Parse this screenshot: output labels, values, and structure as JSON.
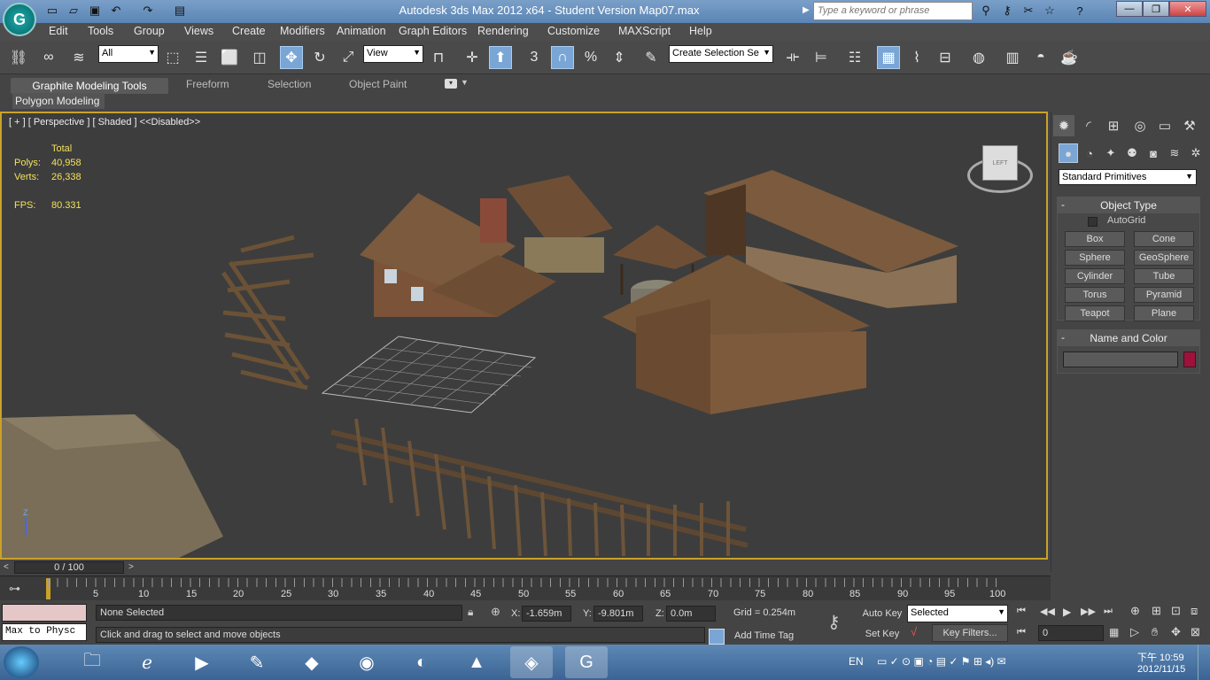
{
  "window": {
    "title": "Autodesk 3ds Max  2012 x64  - Student Version    Map07.max",
    "search_placeholder": "Type a keyword or phrase"
  },
  "menu": [
    "Edit",
    "Tools",
    "Group",
    "Views",
    "Create",
    "Modifiers",
    "Animation",
    "Graph Editors",
    "Rendering",
    "Customize",
    "MAXScript",
    "Help"
  ],
  "toolbar": {
    "filter_value": "All",
    "refcoord_value": "View",
    "selection_set_placeholder": "Create Selection Se",
    "angle_snap": "3"
  },
  "ribbon": {
    "tabs": [
      "Graphite Modeling Tools",
      "Freeform",
      "Selection",
      "Object Paint"
    ],
    "active_panel": "Polygon Modeling"
  },
  "viewport": {
    "label": "[ + ] [ Perspective ] [ Shaded ] <<Disabled>>",
    "stats": {
      "header": "Total",
      "polys_label": "Polys:",
      "polys": "40,958",
      "verts_label": "Verts:",
      "verts": "26,338",
      "fps_label": "FPS:",
      "fps": "80.331"
    },
    "viewcube_label": "LEFT",
    "axis_label": "Z"
  },
  "command_panel": {
    "dropdown": "Standard Primitives",
    "object_type": {
      "title": "Object Type",
      "autogrid": "AutoGrid",
      "buttons": [
        "Box",
        "Cone",
        "Sphere",
        "GeoSphere",
        "Cylinder",
        "Tube",
        "Torus",
        "Pyramid",
        "Teapot",
        "Plane"
      ]
    },
    "name_color": {
      "title": "Name and Color",
      "swatch": "#a0103a"
    }
  },
  "timeline": {
    "slider": "0 / 100",
    "ticks": [
      "5",
      "10",
      "15",
      "20",
      "25",
      "30",
      "35",
      "40",
      "45",
      "50",
      "55",
      "60",
      "65",
      "70",
      "75",
      "80",
      "85",
      "90",
      "95",
      "100"
    ]
  },
  "status": {
    "maxscript": "Max to Physc",
    "selection": "None Selected",
    "prompt": "Click and drag to select and move objects",
    "x_label": "X:",
    "x": "-1.659m",
    "y_label": "Y:",
    "y": "-9.801m",
    "z_label": "Z:",
    "z": "0.0m",
    "grid": "Grid = 0.254m",
    "add_time_tag": "Add Time Tag",
    "auto_key": "Auto Key",
    "set_key": "Set Key",
    "key_mode": "Selected",
    "key_filters": "Key Filters...",
    "frame": "0"
  },
  "taskbar": {
    "lang": "EN",
    "time": "下午 10:59",
    "date": "2012/11/15"
  }
}
